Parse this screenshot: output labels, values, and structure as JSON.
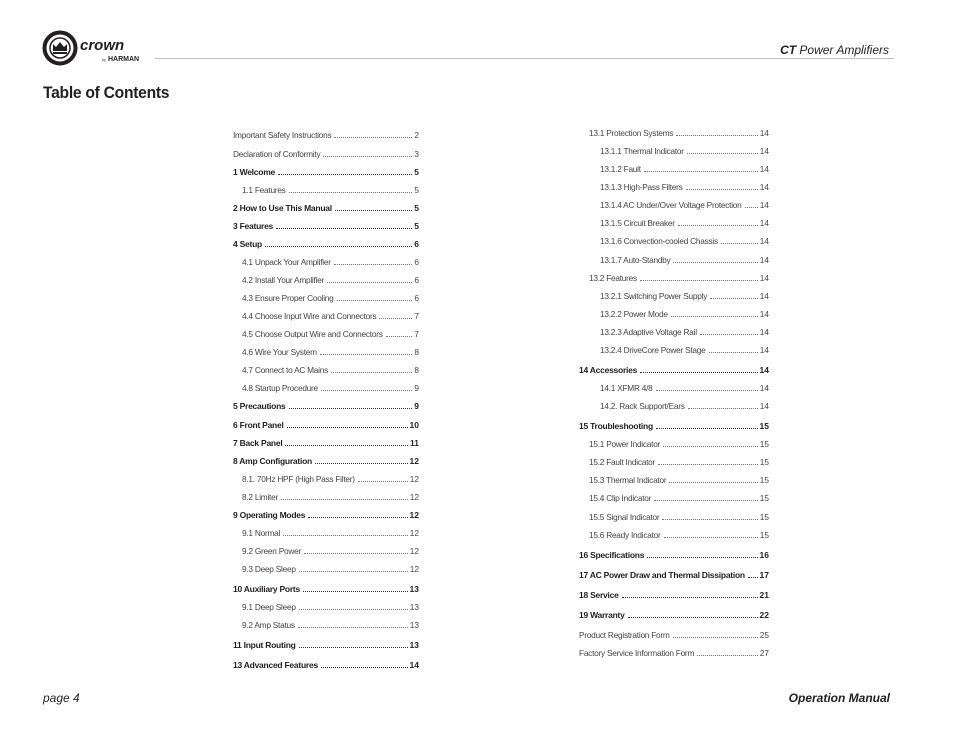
{
  "header": {
    "brand_logo": "crown by HARMAN",
    "product_bold": "CT",
    "product_rest": " Power Amplifiers"
  },
  "title": "Table of Contents",
  "toc_left": [
    {
      "label": "Important Safety Instructions",
      "page": "2",
      "level": 0,
      "bold": false
    },
    {
      "label": "Declaration of Conformity",
      "page": "3",
      "level": 0,
      "bold": false
    },
    {
      "label": "1 Welcome",
      "page": "5",
      "level": 0,
      "bold": true
    },
    {
      "label": "1.1 Features",
      "page": "5",
      "level": 1,
      "bold": false
    },
    {
      "label": "2 How to Use This Manual",
      "page": "5",
      "level": 0,
      "bold": true
    },
    {
      "label": "3 Features",
      "page": "5",
      "level": 0,
      "bold": true
    },
    {
      "label": "4 Setup",
      "page": "6",
      "level": 0,
      "bold": true
    },
    {
      "label": "4.1 Unpack Your Amplifier",
      "page": "6",
      "level": 1,
      "bold": false
    },
    {
      "label": "4.2 Install Your Amplifier",
      "page": "6",
      "level": 1,
      "bold": false
    },
    {
      "label": "4.3 Ensure Proper Cooling",
      "page": "6",
      "level": 1,
      "bold": false
    },
    {
      "label": "4.4 Choose Input Wire and Connectors",
      "page": "7",
      "level": 1,
      "bold": false
    },
    {
      "label": "4.5 Choose Output Wire and Connectors",
      "page": "7",
      "level": 1,
      "bold": false
    },
    {
      "label": "4.6 Wire Your System",
      "page": "8",
      "level": 1,
      "bold": false
    },
    {
      "label": "4.7 Connect to AC Mains",
      "page": "8",
      "level": 1,
      "bold": false
    },
    {
      "label": "4.8 Startup Procedure",
      "page": "9",
      "level": 1,
      "bold": false
    },
    {
      "label": "5 Precautions",
      "page": "9",
      "level": 0,
      "bold": true
    },
    {
      "label": "6 Front Panel",
      "page": "10",
      "level": 0,
      "bold": true
    },
    {
      "label": "7 Back Panel",
      "page": "11",
      "level": 0,
      "bold": true
    },
    {
      "label": "8 Amp Configuration",
      "page": "12",
      "level": 0,
      "bold": true
    },
    {
      "label": "8.1. 70Hz HPF (High Pass Filter)",
      "page": "12",
      "level": 1,
      "bold": false
    },
    {
      "label": "8.2 Limiter",
      "page": "12",
      "level": 1,
      "bold": false
    },
    {
      "label": "9 Operating Modes",
      "page": "12",
      "level": 0,
      "bold": true
    },
    {
      "label": "9.1 Normal",
      "page": "12",
      "level": 1,
      "bold": false
    },
    {
      "label": "9.2 Green Power",
      "page": "12",
      "level": 1,
      "bold": false
    },
    {
      "label": "9.3 Deep Sleep",
      "page": "12",
      "level": 1,
      "bold": false
    },
    {
      "label": "10 Auxiliary Ports",
      "page": "13",
      "level": 0,
      "bold": true
    },
    {
      "label": "9.1 Deep Sleep",
      "page": "13",
      "level": 1,
      "bold": false
    },
    {
      "label": "9.2 Amp Status",
      "page": "13",
      "level": 1,
      "bold": false
    },
    {
      "label": "11 Input Routing",
      "page": "13",
      "level": 0,
      "bold": true
    },
    {
      "label": "13 Advanced Features",
      "page": "14",
      "level": 0,
      "bold": true
    }
  ],
  "toc_right": [
    {
      "label": "13.1 Protection Systems",
      "page": "14",
      "level": 1,
      "bold": false
    },
    {
      "label": "13.1.1 Thermal Indicator",
      "page": "14",
      "level": 2,
      "bold": false
    },
    {
      "label": "13.1.2 Fault",
      "page": "14",
      "level": 2,
      "bold": false
    },
    {
      "label": "13.1.3 High-Pass Filters",
      "page": "14",
      "level": 2,
      "bold": false
    },
    {
      "label": "13.1.4 AC Under/Over Voltage Protection",
      "page": "14",
      "level": 2,
      "bold": false
    },
    {
      "label": "13.1.5 Circuit Breaker",
      "page": "14",
      "level": 2,
      "bold": false
    },
    {
      "label": "13.1.6 Convection-cooled Chassis",
      "page": "14",
      "level": 2,
      "bold": false
    },
    {
      "label": "13.1.7 Auto-Standby",
      "page": "14",
      "level": 2,
      "bold": false
    },
    {
      "label": "13.2 Features",
      "page": "14",
      "level": 1,
      "bold": false
    },
    {
      "label": "13.2.1 Switching Power Supply",
      "page": "14",
      "level": 2,
      "bold": false
    },
    {
      "label": "13.2.2 Power Mode",
      "page": "14",
      "level": 2,
      "bold": false
    },
    {
      "label": "13.2.3 Adaptive Voltage Rail",
      "page": "14",
      "level": 2,
      "bold": false
    },
    {
      "label": "13.2.4 DriveCore Power Stage",
      "page": "14",
      "level": 2,
      "bold": false
    },
    {
      "label": "14 Accessories",
      "page": "14",
      "level": 0,
      "bold": true
    },
    {
      "label": "14.1 XFMR 4/8",
      "page": "14",
      "level": 2,
      "bold": false
    },
    {
      "label": "14.2. Rack Support/Ears",
      "page": "14",
      "level": 2,
      "bold": false
    },
    {
      "label": "15 Troubleshooting",
      "page": "15",
      "level": 0,
      "bold": true
    },
    {
      "label": "15.1 Power Indicator",
      "page": "15",
      "level": 1,
      "bold": false
    },
    {
      "label": "15.2 Fault Indicator",
      "page": "15",
      "level": 1,
      "bold": false
    },
    {
      "label": "15.3 Thermal Indicator",
      "page": "15",
      "level": 1,
      "bold": false
    },
    {
      "label": "15.4 Clip Indicator",
      "page": "15",
      "level": 1,
      "bold": false
    },
    {
      "label": "15.5 Signal Indicator",
      "page": "15",
      "level": 1,
      "bold": false
    },
    {
      "label": "15.6 Ready Indicator",
      "page": "15",
      "level": 1,
      "bold": false
    },
    {
      "label": "16 Specifications",
      "page": "16",
      "level": 0,
      "bold": true
    },
    {
      "label": "17 AC Power Draw and Thermal Dissipation",
      "page": "17",
      "level": 0,
      "bold": true
    },
    {
      "label": "18 Service",
      "page": "21",
      "level": 0,
      "bold": true
    },
    {
      "label": "19 Warranty",
      "page": "22",
      "level": 0,
      "bold": true
    },
    {
      "label": "Product Registration Form",
      "page": "25",
      "level": 0,
      "bold": false
    },
    {
      "label": "Factory Service Information Form",
      "page": "27",
      "level": 0,
      "bold": false
    }
  ],
  "footer": {
    "page_label": "page 4",
    "manual": "Operation Manual"
  }
}
